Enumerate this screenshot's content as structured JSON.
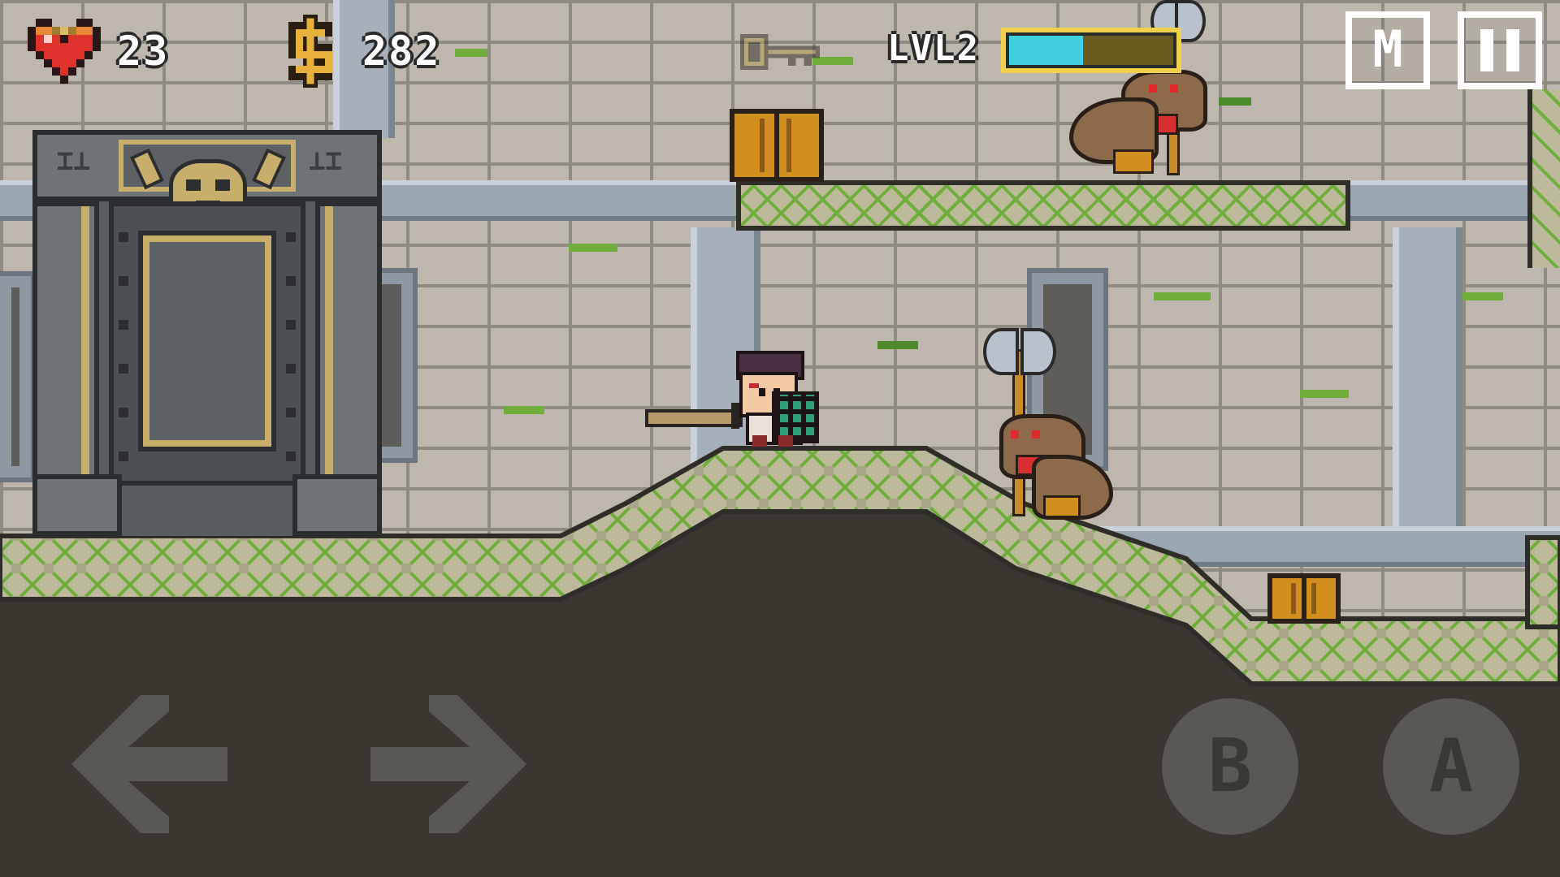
{
  "hud": {
    "health_icon": "heart-icon",
    "health_value": "23",
    "coins_icon": "dollar-coin-icon",
    "coins_value": "282",
    "key_icon": "key-icon",
    "key_collected": false,
    "level_label": "LVL2",
    "level_progress": 0.45,
    "map_button_label": "M",
    "pause_button_icon": "pause-icon"
  },
  "controls": {
    "left_icon": "arrow-left-icon",
    "right_icon": "arrow-right-icon",
    "b_label": "B",
    "a_label": "A"
  },
  "scene": {
    "player": "hero-swordsman",
    "enemies": [
      "werewolf-axe-upper",
      "werewolf-axe-ground"
    ],
    "door_icon": "horned-skull-icon",
    "crates": 2
  },
  "colors": {
    "stone_wall": "#bdb7ad",
    "moss": "#6fae3a",
    "ground_dark": "#3a3630",
    "gold_trim": "#c9ad6a",
    "xp_fill": "#3fd0e0",
    "xp_frame": "#f2d04c",
    "crate": "#d38f1e"
  }
}
